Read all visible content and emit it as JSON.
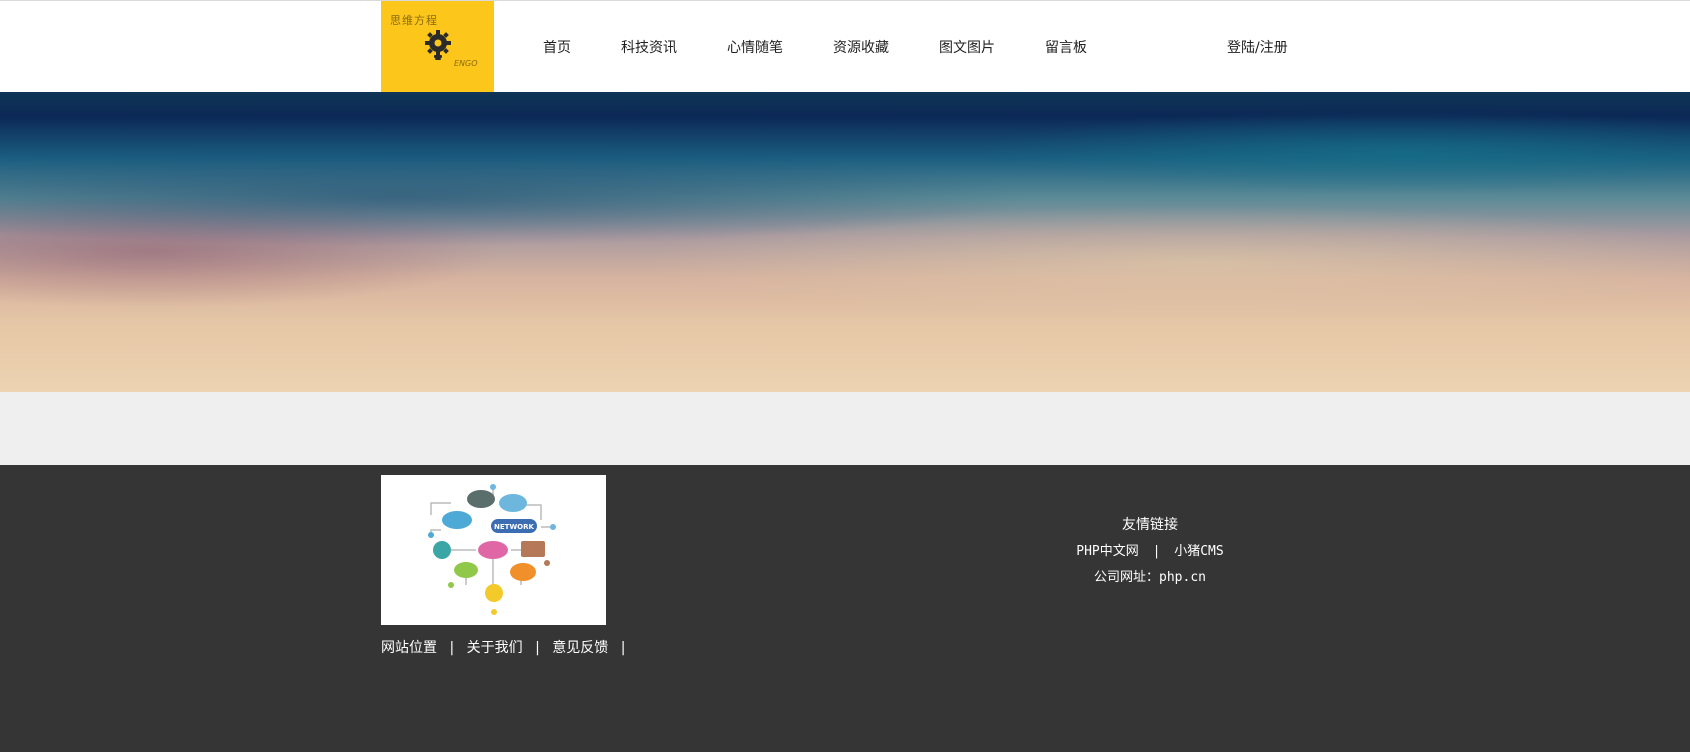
{
  "logo": {
    "top_text": "思维方程",
    "bottom_text": "ENGO",
    "icon": "lightbulb-gear-icon",
    "bg_color": "#fcc61a"
  },
  "nav": {
    "items": [
      {
        "label": "首页"
      },
      {
        "label": "科技资讯"
      },
      {
        "label": "心情随笔"
      },
      {
        "label": "资源收藏"
      },
      {
        "label": "图文图片"
      },
      {
        "label": "留言板"
      }
    ],
    "login_label": "登陆/注册"
  },
  "hero": {
    "image": "sky-gradient-banner"
  },
  "footer": {
    "image": "network-diagram-image",
    "image_text": "NETWORK",
    "links": [
      "网站位置",
      "关于我们",
      "意见反馈"
    ],
    "separator": "|",
    "friend_title": "友情链接",
    "friend_links": [
      "PHP中文网",
      "小猪CMS"
    ],
    "company_label": "公司网址：",
    "company_url": "php.cn",
    "bg_color": "#343534"
  }
}
